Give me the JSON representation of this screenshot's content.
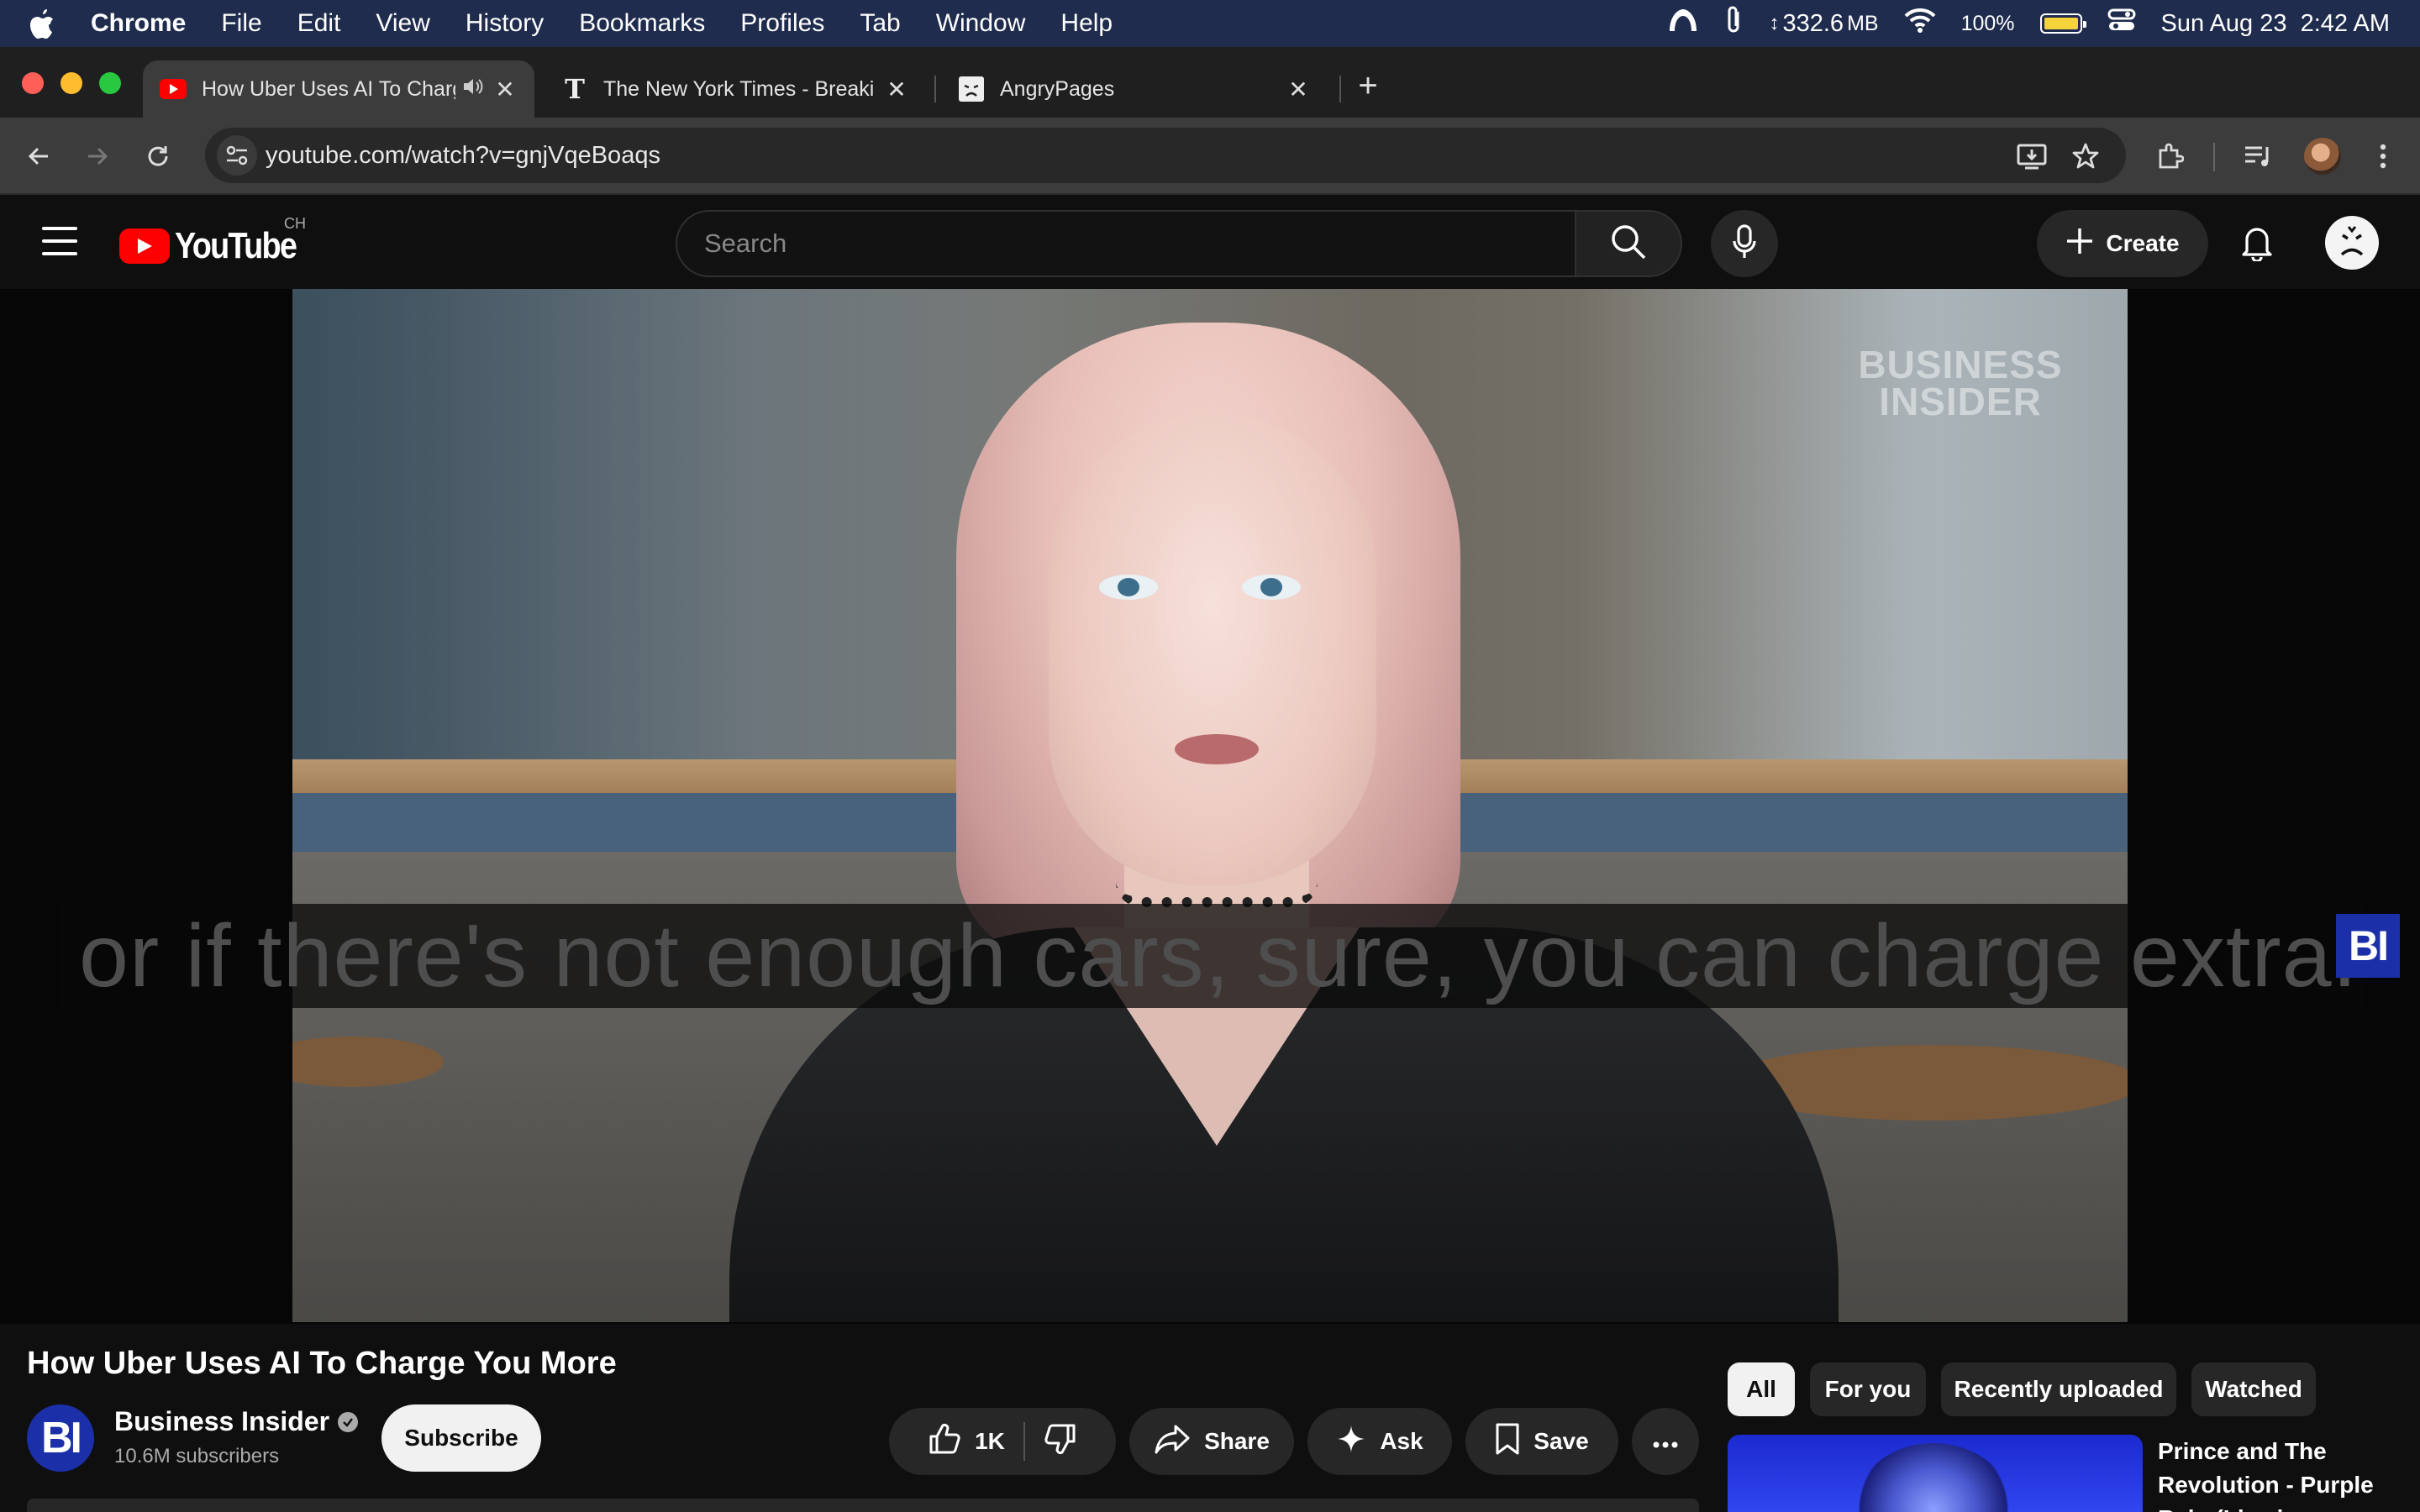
{
  "menubar": {
    "app": "Chrome",
    "items": [
      "File",
      "Edit",
      "View",
      "History",
      "Bookmarks",
      "Profiles",
      "Tab",
      "Window",
      "Help"
    ],
    "memory": "332.6",
    "memory_unit": "MB",
    "battery": "100%",
    "datetime": "Sun Aug 23  2:42 AM",
    "icons": [
      "apple-icon",
      "nebula-icon",
      "paperclip-icon",
      "memory-icon",
      "wifi-icon",
      "battery-icon",
      "control-center-icon"
    ]
  },
  "tabs": [
    {
      "title": "How Uber Uses AI To Charge You More",
      "favicon": "youtube-icon",
      "audio": true,
      "active": true
    },
    {
      "title": "The New York Times - Breaking News",
      "favicon": "nyt-icon",
      "active": false
    },
    {
      "title": "AngryPages",
      "favicon": "angrypages-icon",
      "active": false
    }
  ],
  "toolbar": {
    "url": "youtube.com/watch?v=gnjVqeBoaqs"
  },
  "youtube": {
    "logo_text": "YouTube",
    "country": "CH",
    "search_placeholder": "Search",
    "create_label": "Create"
  },
  "video": {
    "watermark_line1": "BUSINESS",
    "watermark_line2": "INSIDER",
    "caption": "or if there's not enough cars, sure, you can charge extra.",
    "badge": "BI"
  },
  "details": {
    "title": "How Uber Uses AI To Charge You More",
    "channel_initials": "BI",
    "channel_name": "Business Insider",
    "subscribers": "10.6M subscribers",
    "subscribe_label": "Subscribe",
    "likes": "1K",
    "share_label": "Share",
    "ask_label": "Ask",
    "save_label": "Save"
  },
  "chips": [
    "All",
    "For you",
    "Recently uploaded",
    "Watched"
  ],
  "recommendation": {
    "title": "Prince and The Revolution - Purple Rain (Live in Syracuse)"
  },
  "colors": {
    "menubar": "#1f2c4d",
    "youtube_red": "#ff0000",
    "bi_blue": "#1b2fa8",
    "background": "#0f0f0f"
  }
}
